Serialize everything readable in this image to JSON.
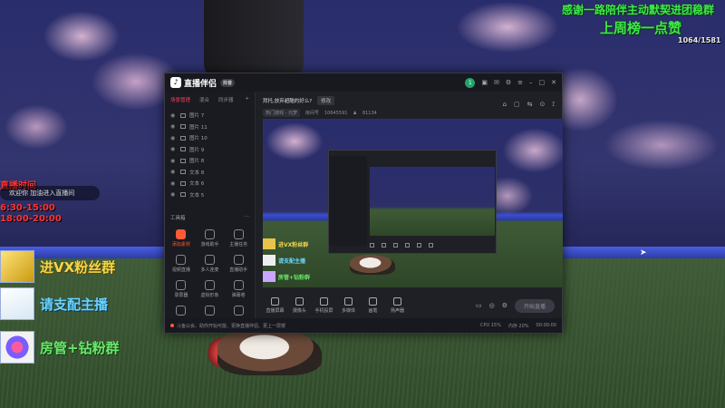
{
  "overlay": {
    "top_banner_1": "感谢一路陪伴主动默契进团稳群",
    "top_banner_2": "上周榜一点赞",
    "top_small": "1064/1581",
    "live_time_title": "直播时间",
    "live_time_1": "6:30-15:00",
    "live_time_2": "18:00-20:00",
    "enter_message": "欢迎你 加油进入直播间",
    "promos": [
      {
        "label": "进VX粉丝群",
        "icon": "gold-bars-icon"
      },
      {
        "label": "请支配主播",
        "icon": "jet-icon"
      },
      {
        "label": "房管+钻粉群",
        "icon": "diamond-ring-icon"
      }
    ]
  },
  "app": {
    "name": "直播伴侣",
    "version": "抖音",
    "avatar_letter": "1",
    "sidebar_tabs": [
      "场景管理",
      "混合",
      "同步器"
    ],
    "layers": [
      {
        "label": "图片 7"
      },
      {
        "label": "图片 11"
      },
      {
        "label": "图片 10"
      },
      {
        "label": "图片 9"
      },
      {
        "label": "图片 8"
      },
      {
        "label": "文本 8"
      },
      {
        "label": "文本 6"
      },
      {
        "label": "文本 5"
      }
    ],
    "tools_header": "工具箱",
    "tools": [
      {
        "label": "添加素材",
        "highlight": true
      },
      {
        "label": "游戏助手",
        "highlight": false
      },
      {
        "label": "主播任务",
        "highlight": false
      },
      {
        "label": "视频直播",
        "highlight": false
      },
      {
        "label": "多人连麦",
        "highlight": false
      },
      {
        "label": "直播助手",
        "highlight": false
      },
      {
        "label": "录屏器",
        "highlight": false
      },
      {
        "label": "虚拟形象",
        "highlight": false
      },
      {
        "label": "弹幕卷",
        "highlight": false
      },
      {
        "label": "",
        "highlight": false
      },
      {
        "label": "",
        "highlight": false
      },
      {
        "label": "",
        "highlight": false
      }
    ],
    "stream_title": "拜托,放弃超酷的好么?",
    "edit_label": "修改",
    "stream_category": "热门游戏 - 元梦",
    "stream_room": "10645591",
    "stream_viewers": "81134",
    "mini_promos": [
      "进VX粉丝群",
      "请支配主播",
      "房管+钻粉群"
    ],
    "bottom_items": [
      "直播屏幕",
      "摄像头",
      "手机投屏",
      "多媒体",
      "画笔",
      "扬声器"
    ],
    "live_button": "开始直播",
    "status_message": "斗鱼公会、助你开始可能、更换直播伴侣、更上一层楼",
    "status_stats": [
      "CPU 15%",
      "内存 20%",
      "00:00:00"
    ]
  },
  "colors": {
    "accent": "#ff3b5c",
    "highlight_tool": "#ff5a36",
    "overlay_green": "#3ee84a",
    "live_time_red": "#ff3333"
  }
}
